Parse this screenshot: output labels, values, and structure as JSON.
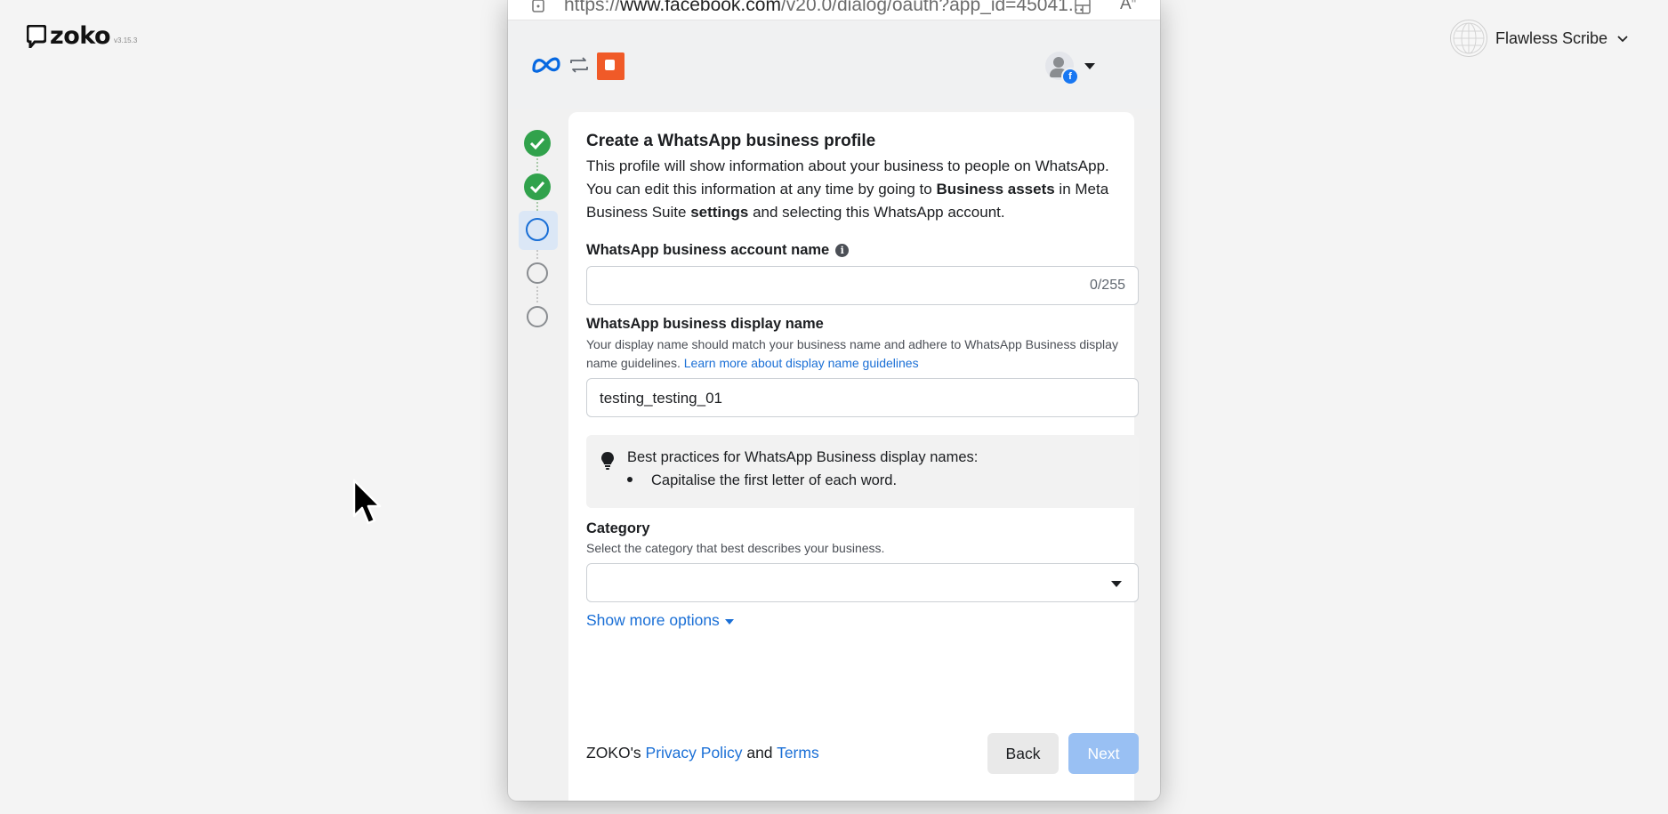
{
  "app": {
    "brand": "zoko",
    "version": "v3.15.3",
    "user_name": "Flawless Scribe"
  },
  "browser": {
    "url_prefix": "https://",
    "url_domain": "www.facebook.com",
    "url_path": "/v20.0/dialog/oauth?app_id=45041..."
  },
  "dialog": {
    "title": "Create a WhatsApp business profile",
    "intro_part1": "This profile will show information about your business to people on WhatsApp. You can edit this information at any time by going to ",
    "intro_bold1": "Business assets",
    "intro_part2": " in Meta Business Suite ",
    "intro_bold2": "settings",
    "intro_part3": " and selecting this WhatsApp account.",
    "account_name": {
      "label": "WhatsApp business account name",
      "value": "",
      "counter": "0/255"
    },
    "display_name": {
      "label": "WhatsApp business display name",
      "help": "Your display name should match your business name and adhere to WhatsApp Business display name guidelines. ",
      "help_link": "Learn more about display name guidelines",
      "value": "testing_testing_01"
    },
    "tip": {
      "title": "Best practices for WhatsApp Business display names:",
      "items": [
        "Capitalise the first letter of each word."
      ]
    },
    "category": {
      "label": "Category",
      "help": "Select the category that best describes your business.",
      "value": ""
    },
    "show_more": "Show more options",
    "footer": {
      "prefix": "ZOKO's ",
      "privacy": "Privacy Policy",
      "and": " and ",
      "terms": "Terms"
    },
    "back_label": "Back",
    "next_label": "Next"
  },
  "stepper": {
    "steps": [
      "complete",
      "complete",
      "current",
      "pending",
      "pending"
    ]
  },
  "colors": {
    "accent": "#1a6fd6",
    "success": "#31a24c",
    "next_disabled": "#99c0f3",
    "app_icon": "#f05a28"
  },
  "icons": {
    "info": "i"
  }
}
